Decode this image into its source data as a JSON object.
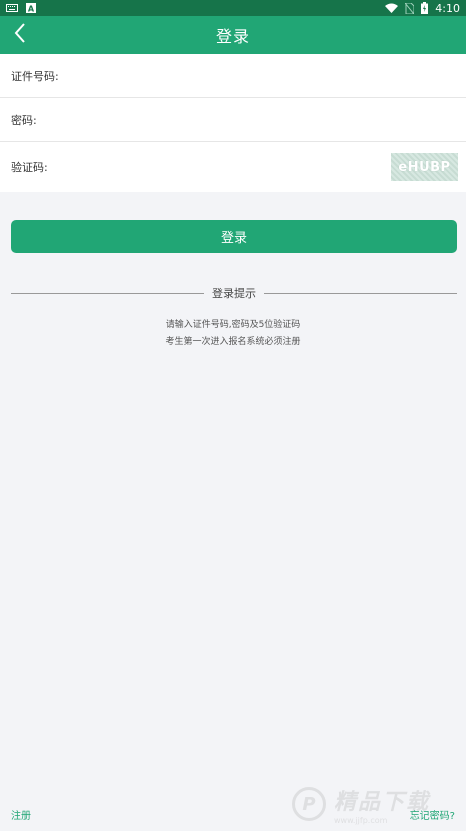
{
  "status_bar": {
    "time": "4:10",
    "left_icons": [
      "keyboard-icon",
      "a-badge-icon"
    ],
    "right_icons": [
      "wifi-icon",
      "no-sim-icon",
      "battery-icon"
    ]
  },
  "app_bar": {
    "title": "登录",
    "back_icon": "chevron-left-icon",
    "color": "#21a675"
  },
  "form": {
    "id_label": "证件号码:",
    "password_label": "密码:",
    "captcha_label": "验证码:",
    "captcha_text": "eHUBP"
  },
  "login_button": {
    "label": "登录"
  },
  "tips": {
    "title": "登录提示",
    "lines": [
      "请输入证件号码,密码及5位验证码",
      "考生第一次进入报名系统必须注册"
    ]
  },
  "footer": {
    "register": "注册",
    "forgot": "忘记密码?"
  },
  "watermark": {
    "text": "精品下载",
    "sub": "www.jjfp.com"
  },
  "colors": {
    "status_bar": "#16744a",
    "accent": "#21a675",
    "background": "#f3f4f7"
  }
}
